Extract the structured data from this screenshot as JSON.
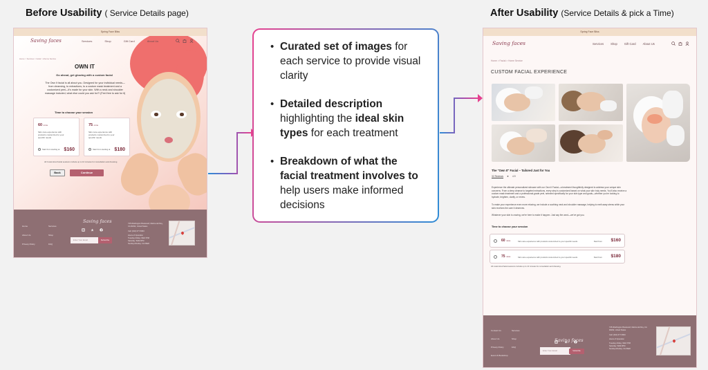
{
  "headings": {
    "before_title": "Before Usability",
    "before_sub": "( Service Details page)",
    "after_title": "After Usability",
    "after_sub": "(Service Details & pick a Time)"
  },
  "colors": {
    "arrow_magenta": "#e5418f",
    "arrow_blue": "#2e8cd6",
    "brand": "#8b3b4f",
    "footer": "#8e6f73",
    "promo": "#f2dfcb",
    "button": "#b4606f"
  },
  "callout": {
    "bullets": [
      {
        "lines": [
          [
            {
              "t": "Curated set of images",
              "b": true
            },
            {
              "t": " for",
              "b": false
            }
          ],
          [
            {
              "t": "each service to provide visual",
              "b": false
            }
          ],
          [
            {
              "t": "clarity",
              "b": false
            }
          ]
        ]
      },
      {
        "lines": [
          [
            {
              "t": "Detailed description",
              "b": true
            }
          ],
          [
            {
              "t": "highlighting the ",
              "b": false
            },
            {
              "t": "ideal skin",
              "b": true
            }
          ],
          [
            {
              "t": "types",
              "b": true
            },
            {
              "t": " for each treatment",
              "b": false
            }
          ]
        ]
      },
      {
        "lines": [
          [
            {
              "t": "Breakdown of what the",
              "b": true
            }
          ],
          [
            {
              "t": "facial treatment involves to",
              "b": true
            }
          ],
          [
            {
              "t": "help users make informed",
              "b": false
            }
          ],
          [
            {
              "t": "decisions",
              "b": false
            }
          ]
        ]
      }
    ]
  },
  "site": {
    "logo": "Saving faces",
    "promo": "Spring Face Bliss",
    "nav": [
      "Services",
      "Shop",
      "Gift Card",
      "About Us"
    ],
    "icons": [
      "search-icon",
      "bag-icon",
      "user-icon"
    ]
  },
  "before": {
    "breadcrumb": "Home  >  Services  >  facial  >  Ahome Service",
    "title": "OWN IT",
    "subtitle": "Go ahead, get glowing with a custom facial",
    "body": "The Own It facial is all about you. Designed for your individual needs—from cleansing, to extractions, to a custom mask treatment and a customized peel—it's made for your skin. With a neck and shoulder massage included, what else could you ask for?! (Feel free to ask for it)",
    "session_heading": "Time to choose your session",
    "options": [
      {
        "mins": "60",
        "unit": "mins",
        "desc": "Skin care experience with products customized to your specific needs",
        "start": "Start from starting at",
        "price": "$160"
      },
      {
        "mins": "75",
        "unit": "mins",
        "desc": "Skin care experience with products customized to your specific needs",
        "start": "Start from starting at",
        "price": "$180"
      }
    ],
    "note": "All Customized facial sessions include up to 10 minutes for consultation and dressing.",
    "back": "Back",
    "continue": "Continue"
  },
  "footer": {
    "col1": [
      "Home",
      "About Us",
      "Privacy Policy"
    ],
    "col2": [
      "Services",
      "Shop",
      "FAQ"
    ],
    "col1_after": [
      "Contact Us",
      "About Us",
      "Privacy Policy",
      "Event & Bookshop"
    ],
    "col2_after": [
      "Services",
      "Shop",
      "FAQ"
    ],
    "address": "745 Washington Boulevard, Marina del Rey, CA 90292, United States",
    "phone": "Call: (310) 677-5663",
    "hours_title": "Hours of Operation",
    "hours": [
      "Tuesday-Friday: 9AM-7PM",
      "Saturday: 8AM-6PM",
      "Sunday-Monday: CLOSED"
    ],
    "email_placeholder": "Enter Your Email",
    "subscribe": "Subscribe"
  },
  "after": {
    "breadcrumb": "Home  >  Facial  >  Home Service",
    "title": "CUSTOM FACIAL EXPERIENCE",
    "product_title": "The \"Own It\" Facial – Tailored Just for You",
    "reviews": "32 Reviews",
    "rating": "4.9",
    "para1": "Experience the ultimate personalized skincare with our Own It Facial—a treatment thoughtfully designed to address your unique skin concerns. From a deep cleanse to targeted extractions, every step is customized based on what your skin truly needs. You'll also receive a custom mask treatment and a professional-grade peel, selected specifically for your skin type and goals—whether you're looking to hydrate, brighten, clarify, or renew.",
    "para2": "To make your experience even more relaxing, we include a soothing neck and shoulder massage, helping to melt away stress while your skin receives the care it deserves.",
    "para3": "Whatever your skin is craving, we're here to make it happen. Just say the word—we've got you.",
    "session_heading": "Time to choose your session",
    "options": [
      {
        "mins": "60",
        "unit": "mins",
        "desc": "Skin care experience with products customized to your specific needs",
        "start": "Start from",
        "price": "$160"
      },
      {
        "mins": "75",
        "unit": "mins",
        "desc": "Skin care experience with products customized to your specific needs",
        "start": "Start from",
        "price": "$180"
      }
    ],
    "note": "All customized facial sessions include up to 10 minutes for consultation and dressing."
  }
}
